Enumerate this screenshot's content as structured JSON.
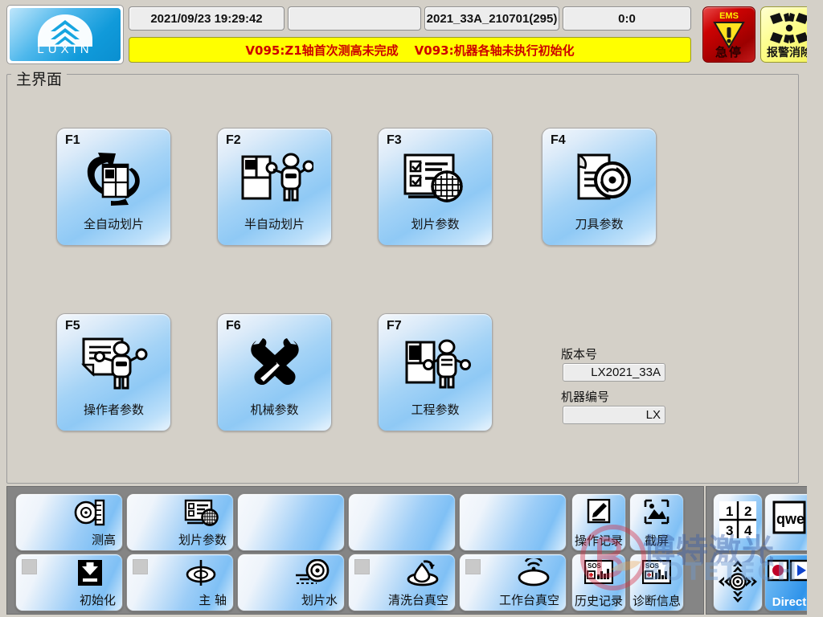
{
  "window": {
    "title": "主界面"
  },
  "brand": {
    "logo_text": "LUXIN",
    "watermark_cn": "博特激光",
    "watermark_en": "BOTETECH"
  },
  "header": {
    "datetime": "2021/09/23 19:29:42",
    "blank_field": "",
    "recipe": "2021_33A_210701(295)",
    "timer": "0:0",
    "alarm_1": "V095:Z1轴首次测高未完成",
    "alarm_2": "V093:机器各轴未执行初始化",
    "alarm_color": "#cc0000",
    "alarm_bg": "#ffff00",
    "ems": {
      "label": "EMS",
      "cn": "急停",
      "icon": "warning-triangle-icon",
      "color": "#cc0202"
    },
    "alarm_clear": {
      "cn": "报警消除",
      "icon": "starburst-icon",
      "color": "#fdfd8c"
    }
  },
  "main": {
    "buttons": [
      {
        "key": "F1",
        "label": "全自动划片",
        "icon": "auto-dicing-icon"
      },
      {
        "key": "F2",
        "label": "半自动划片",
        "icon": "semi-auto-dicing-icon"
      },
      {
        "key": "F3",
        "label": "划片参数",
        "icon": "dicing-parameters-icon"
      },
      {
        "key": "F4",
        "label": "刀具参数",
        "icon": "blade-parameters-icon"
      },
      {
        "key": "F5",
        "label": "操作者参数",
        "icon": "operator-parameters-icon"
      },
      {
        "key": "F6",
        "label": "机械参数",
        "icon": "wrench-screwdriver-icon"
      },
      {
        "key": "F7",
        "label": "工程参数",
        "icon": "engineering-parameters-icon"
      }
    ],
    "info": {
      "version_label": "版本号",
      "version_value": "LX2021_33A",
      "machine_id_label": "机器编号",
      "machine_id_value": "LX"
    }
  },
  "toolbar": {
    "row_top": [
      {
        "label": "测高",
        "icon": "height-measure-icon",
        "empty": false
      },
      {
        "label": "划片参数",
        "icon": "dicing-parameters-icon",
        "empty": false
      },
      {
        "label": "",
        "icon": "",
        "empty": true
      },
      {
        "label": "",
        "icon": "",
        "empty": true
      },
      {
        "label": "",
        "icon": "",
        "empty": true
      }
    ],
    "row_bottom": [
      {
        "label": "初始化",
        "icon": "initialize-down-arrow-icon",
        "led": true
      },
      {
        "label": "主 轴",
        "icon": "spindle-icon",
        "led": true
      },
      {
        "label": "划片水",
        "icon": "dicing-water-icon",
        "led": true
      },
      {
        "label": "清洗台真空",
        "icon": "clean-table-vacuum-icon",
        "led": true
      },
      {
        "label": "工作台真空",
        "icon": "work-table-vacuum-icon",
        "led": true
      }
    ],
    "log_buttons": [
      {
        "label": "操作记录",
        "icon": "pencil-note-icon"
      },
      {
        "label": "截屏",
        "icon": "screenshot-image-icon"
      },
      {
        "label": "历史记录",
        "icon": "sos-history-chart-icon"
      },
      {
        "label": "诊断信息",
        "icon": "sos-diagnostic-chart-icon"
      }
    ],
    "right_panel": [
      {
        "label": "",
        "icon": "quadrant-1234-icon",
        "active": false
      },
      {
        "label": "",
        "icon": "qwe-keyboard-icon",
        "active": false
      },
      {
        "label": "",
        "icon": "joystick-arrows-icon",
        "active": false
      },
      {
        "label": "Direct",
        "icon": "record-play-icon",
        "active": true
      }
    ]
  }
}
